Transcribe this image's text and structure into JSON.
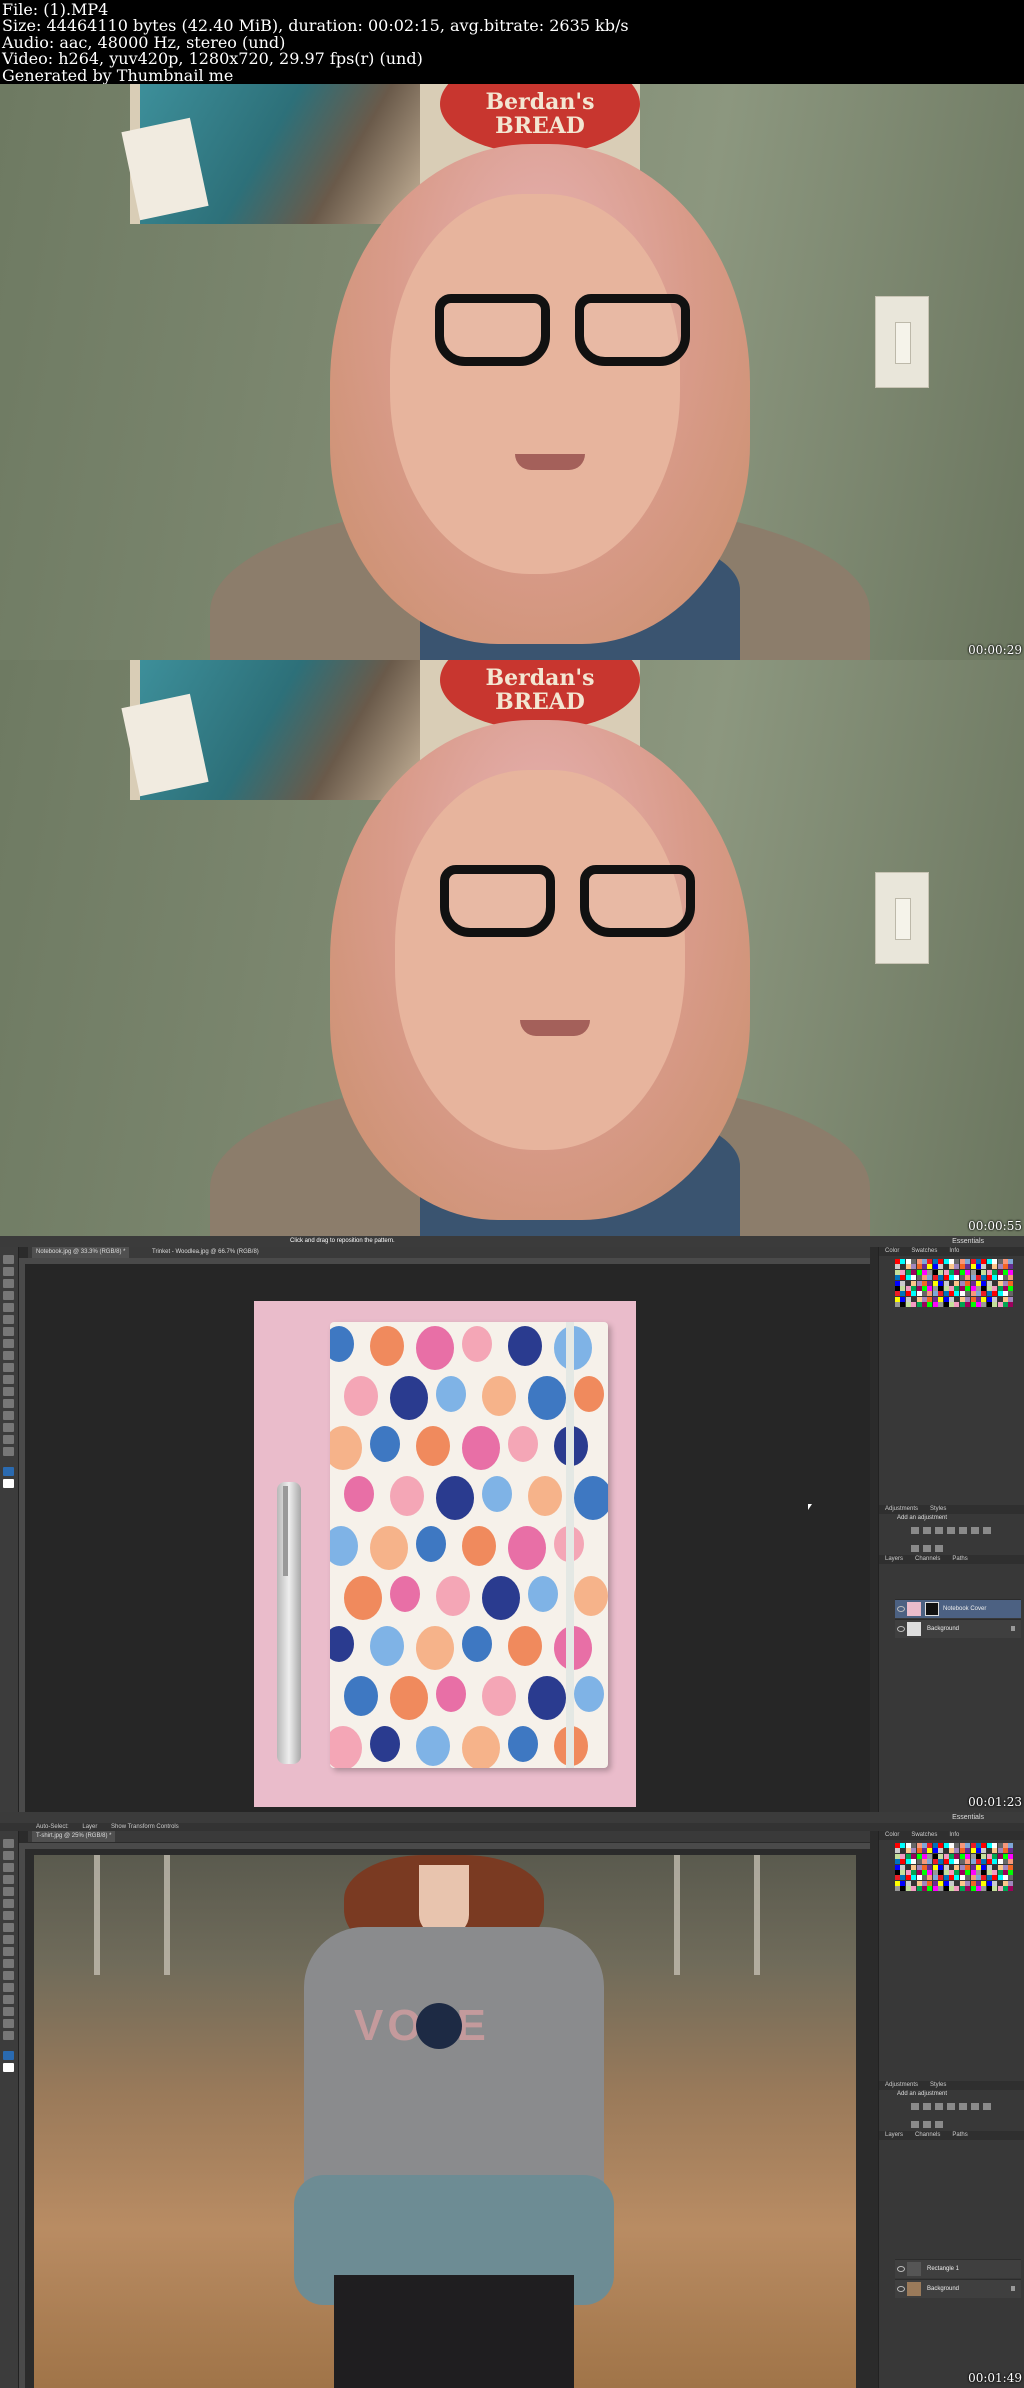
{
  "header": {
    "line1": "File: (1).MP4",
    "line2": "Size: 44464110 bytes (42.40 MiB), duration: 00:02:15, avg.bitrate: 2635 kb/s",
    "line3": "Audio: aac, 48000 Hz, stereo (und)",
    "line4": "Video: h264, yuv420p, 1280x720, 29.97 fps(r) (und)",
    "line5": "Generated by Thumbnail me"
  },
  "frames": [
    {
      "timestamp": "00:00:29",
      "sign_text": "Berdan's\nBREAD"
    },
    {
      "timestamp": "00:00:55",
      "sign_text": "Berdan's\nBREAD"
    },
    {
      "timestamp": "00:01:23",
      "hint": "Click and drag to reposition the pattern.",
      "workspace": "Essentials",
      "tabs": [
        "Notebook.jpg @ 33.3% (RGB/8) *",
        "Trinket - Woodlea.jpg @ 66.7% (RGB/8)"
      ],
      "panel_tabs": [
        "Color",
        "Swatches",
        "Info"
      ],
      "adjust_tabs": [
        "Adjustments",
        "Styles"
      ],
      "adjust_label": "Add an adjustment",
      "layer_tabs": [
        "Layers",
        "Channels",
        "Paths"
      ],
      "layers": [
        "Notebook Cover",
        "Background"
      ]
    },
    {
      "timestamp": "00:01:49",
      "workspace": "Essentials",
      "options": [
        "Auto-Select:",
        "Layer",
        "Show Transform Controls"
      ],
      "tabs": [
        "T-shirt.jpg @ 25% (RGB/8) *"
      ],
      "panel_tabs": [
        "Color",
        "Swatches",
        "Info"
      ],
      "adjust_tabs": [
        "Adjustments",
        "Styles"
      ],
      "adjust_label": "Add an adjustment",
      "layer_tabs": [
        "Layers",
        "Channels",
        "Paths"
      ],
      "layers": [
        "Rectangle 1",
        "Background"
      ],
      "shirt_text": "VOTE"
    }
  ],
  "colors": {
    "ps_bg": "#2b2b2b",
    "ps_panel": "#383838",
    "selected_layer": "#4c6182",
    "sign_red": "#c8362f"
  }
}
